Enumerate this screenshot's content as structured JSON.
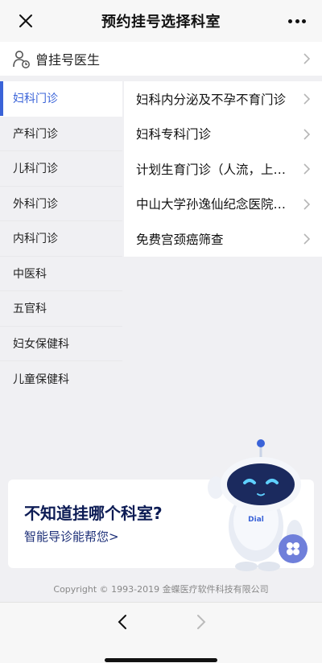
{
  "header": {
    "title": "预约挂号选择科室"
  },
  "previous_doctor": {
    "label": "曾挂号医生"
  },
  "sidebar": {
    "items": [
      {
        "label": "妇科门诊",
        "active": true
      },
      {
        "label": "产科门诊"
      },
      {
        "label": "儿科门诊"
      },
      {
        "label": "外科门诊"
      },
      {
        "label": "内科门诊"
      },
      {
        "label": "中医科"
      },
      {
        "label": "五官科"
      },
      {
        "label": "妇女保健科"
      },
      {
        "label": "儿童保健科"
      }
    ]
  },
  "departments": [
    {
      "label": "妇科内分泌及不孕不育门诊"
    },
    {
      "label": "妇科专科门诊"
    },
    {
      "label": "计划生育门诊（人流，上环等）"
    },
    {
      "label": "中山大学孙逸仙纪念医院专家门诊"
    },
    {
      "label": "免费宫颈癌筛查"
    }
  ],
  "banner": {
    "title": "不知道挂哪个科室?",
    "subtitle": "智能导诊能帮您>",
    "robot_badge": "Dial"
  },
  "footer": {
    "copyright": "Copyright © 1993-2019 金蝶医疗软件科技有限公司"
  },
  "colors": {
    "accent": "#3a63d8",
    "banner_title": "#0c1b54"
  }
}
